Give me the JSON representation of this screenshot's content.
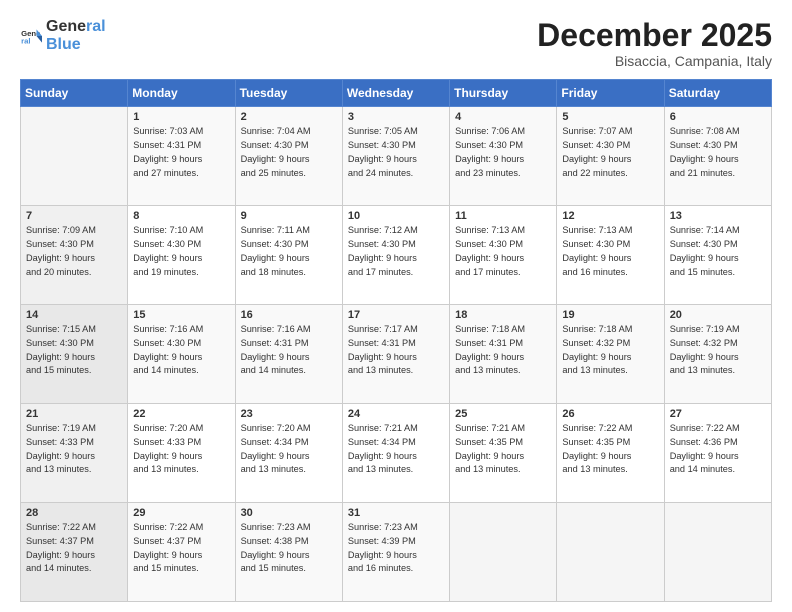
{
  "header": {
    "logo": {
      "general": "General",
      "blue": "Blue"
    },
    "title": "December 2025",
    "location": "Bisaccia, Campania, Italy"
  },
  "days_of_week": [
    "Sunday",
    "Monday",
    "Tuesday",
    "Wednesday",
    "Thursday",
    "Friday",
    "Saturday"
  ],
  "weeks": [
    [
      {
        "num": "",
        "info": ""
      },
      {
        "num": "1",
        "info": "Sunrise: 7:03 AM\nSunset: 4:31 PM\nDaylight: 9 hours\nand 27 minutes."
      },
      {
        "num": "2",
        "info": "Sunrise: 7:04 AM\nSunset: 4:30 PM\nDaylight: 9 hours\nand 25 minutes."
      },
      {
        "num": "3",
        "info": "Sunrise: 7:05 AM\nSunset: 4:30 PM\nDaylight: 9 hours\nand 24 minutes."
      },
      {
        "num": "4",
        "info": "Sunrise: 7:06 AM\nSunset: 4:30 PM\nDaylight: 9 hours\nand 23 minutes."
      },
      {
        "num": "5",
        "info": "Sunrise: 7:07 AM\nSunset: 4:30 PM\nDaylight: 9 hours\nand 22 minutes."
      },
      {
        "num": "6",
        "info": "Sunrise: 7:08 AM\nSunset: 4:30 PM\nDaylight: 9 hours\nand 21 minutes."
      }
    ],
    [
      {
        "num": "7",
        "info": "Sunrise: 7:09 AM\nSunset: 4:30 PM\nDaylight: 9 hours\nand 20 minutes."
      },
      {
        "num": "8",
        "info": "Sunrise: 7:10 AM\nSunset: 4:30 PM\nDaylight: 9 hours\nand 19 minutes."
      },
      {
        "num": "9",
        "info": "Sunrise: 7:11 AM\nSunset: 4:30 PM\nDaylight: 9 hours\nand 18 minutes."
      },
      {
        "num": "10",
        "info": "Sunrise: 7:12 AM\nSunset: 4:30 PM\nDaylight: 9 hours\nand 17 minutes."
      },
      {
        "num": "11",
        "info": "Sunrise: 7:13 AM\nSunset: 4:30 PM\nDaylight: 9 hours\nand 17 minutes."
      },
      {
        "num": "12",
        "info": "Sunrise: 7:13 AM\nSunset: 4:30 PM\nDaylight: 9 hours\nand 16 minutes."
      },
      {
        "num": "13",
        "info": "Sunrise: 7:14 AM\nSunset: 4:30 PM\nDaylight: 9 hours\nand 15 minutes."
      }
    ],
    [
      {
        "num": "14",
        "info": "Sunrise: 7:15 AM\nSunset: 4:30 PM\nDaylight: 9 hours\nand 15 minutes."
      },
      {
        "num": "15",
        "info": "Sunrise: 7:16 AM\nSunset: 4:30 PM\nDaylight: 9 hours\nand 14 minutes."
      },
      {
        "num": "16",
        "info": "Sunrise: 7:16 AM\nSunset: 4:31 PM\nDaylight: 9 hours\nand 14 minutes."
      },
      {
        "num": "17",
        "info": "Sunrise: 7:17 AM\nSunset: 4:31 PM\nDaylight: 9 hours\nand 13 minutes."
      },
      {
        "num": "18",
        "info": "Sunrise: 7:18 AM\nSunset: 4:31 PM\nDaylight: 9 hours\nand 13 minutes."
      },
      {
        "num": "19",
        "info": "Sunrise: 7:18 AM\nSunset: 4:32 PM\nDaylight: 9 hours\nand 13 minutes."
      },
      {
        "num": "20",
        "info": "Sunrise: 7:19 AM\nSunset: 4:32 PM\nDaylight: 9 hours\nand 13 minutes."
      }
    ],
    [
      {
        "num": "21",
        "info": "Sunrise: 7:19 AM\nSunset: 4:33 PM\nDaylight: 9 hours\nand 13 minutes."
      },
      {
        "num": "22",
        "info": "Sunrise: 7:20 AM\nSunset: 4:33 PM\nDaylight: 9 hours\nand 13 minutes."
      },
      {
        "num": "23",
        "info": "Sunrise: 7:20 AM\nSunset: 4:34 PM\nDaylight: 9 hours\nand 13 minutes."
      },
      {
        "num": "24",
        "info": "Sunrise: 7:21 AM\nSunset: 4:34 PM\nDaylight: 9 hours\nand 13 minutes."
      },
      {
        "num": "25",
        "info": "Sunrise: 7:21 AM\nSunset: 4:35 PM\nDaylight: 9 hours\nand 13 minutes."
      },
      {
        "num": "26",
        "info": "Sunrise: 7:22 AM\nSunset: 4:35 PM\nDaylight: 9 hours\nand 13 minutes."
      },
      {
        "num": "27",
        "info": "Sunrise: 7:22 AM\nSunset: 4:36 PM\nDaylight: 9 hours\nand 14 minutes."
      }
    ],
    [
      {
        "num": "28",
        "info": "Sunrise: 7:22 AM\nSunset: 4:37 PM\nDaylight: 9 hours\nand 14 minutes."
      },
      {
        "num": "29",
        "info": "Sunrise: 7:22 AM\nSunset: 4:37 PM\nDaylight: 9 hours\nand 15 minutes."
      },
      {
        "num": "30",
        "info": "Sunrise: 7:23 AM\nSunset: 4:38 PM\nDaylight: 9 hours\nand 15 minutes."
      },
      {
        "num": "31",
        "info": "Sunrise: 7:23 AM\nSunset: 4:39 PM\nDaylight: 9 hours\nand 16 minutes."
      },
      {
        "num": "",
        "info": ""
      },
      {
        "num": "",
        "info": ""
      },
      {
        "num": "",
        "info": ""
      }
    ]
  ]
}
